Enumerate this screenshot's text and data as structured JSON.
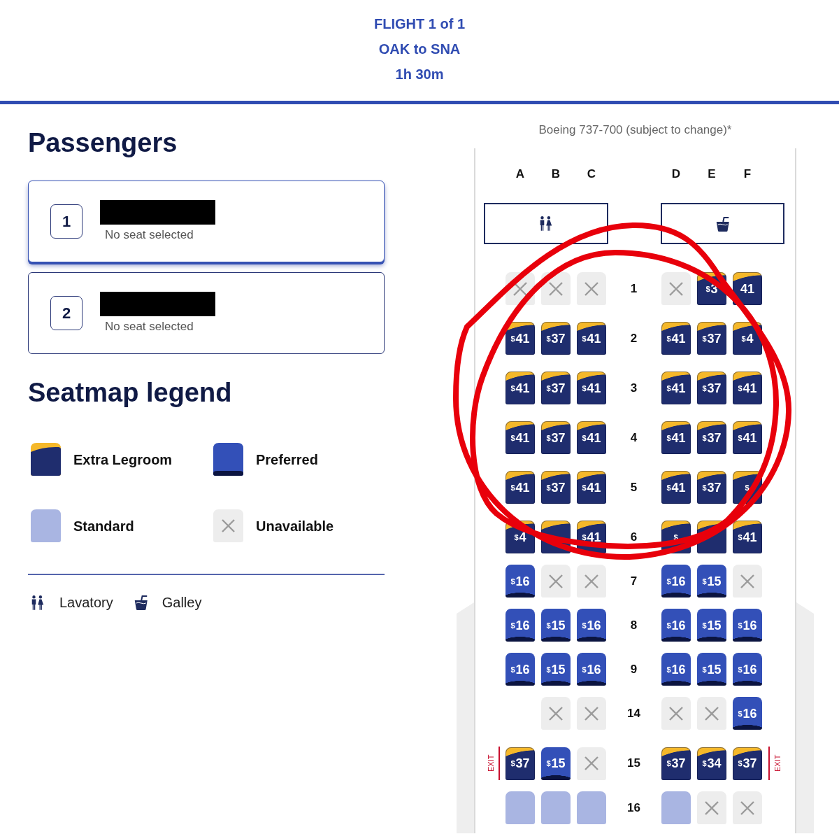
{
  "flight": {
    "title": "FLIGHT 1 of 1",
    "route": "OAK to SNA",
    "duration": "1h 30m"
  },
  "passengers": {
    "heading": "Passengers",
    "items": [
      {
        "number": "1",
        "name_redacted": true,
        "status": "No seat selected",
        "selected": true
      },
      {
        "number": "2",
        "name_redacted": true,
        "status": "No seat selected",
        "selected": false
      }
    ]
  },
  "legend": {
    "heading": "Seatmap legend",
    "items": [
      {
        "kind": "extra_legroom",
        "label": "Extra Legroom"
      },
      {
        "kind": "preferred",
        "label": "Preferred"
      },
      {
        "kind": "standard",
        "label": "Standard"
      },
      {
        "kind": "unavailable",
        "label": "Unavailable"
      }
    ],
    "facilities": [
      {
        "kind": "lavatory",
        "label": "Lavatory"
      },
      {
        "kind": "galley",
        "label": "Galley"
      }
    ]
  },
  "seatmap": {
    "aircraft": "Boeing 737-700 (subject to change)*",
    "columns_left": [
      "A",
      "B",
      "C"
    ],
    "columns_right": [
      "D",
      "E",
      "F"
    ],
    "facilities": [
      {
        "kind": "lavatory"
      },
      {
        "kind": "galley"
      }
    ],
    "rows": [
      {
        "number": "1",
        "left": [
          {
            "kind": "unavailable"
          },
          {
            "kind": "unavailable"
          },
          {
            "kind": "unavailable"
          }
        ],
        "right": [
          {
            "kind": "unavailable"
          },
          {
            "kind": "extra_legroom",
            "price": "$^{$}$3"
          },
          {
            "kind": "extra_legroom",
            "price": "41"
          }
        ]
      },
      {
        "number": "2",
        "left": [
          {
            "kind": "extra_legroom",
            "price": "$^{$}$41"
          },
          {
            "kind": "extra_legroom",
            "price": "$^{$}$37"
          },
          {
            "kind": "extra_legroom",
            "price": "$^{$}$41"
          }
        ],
        "right": [
          {
            "kind": "extra_legroom",
            "price": "$^{$}$41"
          },
          {
            "kind": "extra_legroom",
            "price": "$^{$}$37"
          },
          {
            "kind": "extra_legroom",
            "price": "$^{$}$4"
          }
        ]
      },
      {
        "number": "3",
        "left": [
          {
            "kind": "extra_legroom",
            "price": "$^{$}$41"
          },
          {
            "kind": "extra_legroom",
            "price": "$^{$}$37"
          },
          {
            "kind": "extra_legroom",
            "price": "$^{$}$41"
          }
        ],
        "right": [
          {
            "kind": "extra_legroom",
            "price": "$^{$}$41"
          },
          {
            "kind": "extra_legroom",
            "price": "$^{$}$37"
          },
          {
            "kind": "extra_legroom",
            "price": "$^{$}$41"
          }
        ]
      },
      {
        "number": "4",
        "left": [
          {
            "kind": "extra_legroom",
            "price": "$^{$}$41"
          },
          {
            "kind": "extra_legroom",
            "price": "$^{$}$37"
          },
          {
            "kind": "extra_legroom",
            "price": "$^{$}$41"
          }
        ],
        "right": [
          {
            "kind": "extra_legroom",
            "price": "$^{$}$41"
          },
          {
            "kind": "extra_legroom",
            "price": "$^{$}$37"
          },
          {
            "kind": "extra_legroom",
            "price": "$^{$}$41"
          }
        ]
      },
      {
        "number": "5",
        "left": [
          {
            "kind": "extra_legroom",
            "price": "$^{$}$41"
          },
          {
            "kind": "extra_legroom",
            "price": "$^{$}$37"
          },
          {
            "kind": "extra_legroom",
            "price": "$^{$}$41"
          }
        ],
        "right": [
          {
            "kind": "extra_legroom",
            "price": "$^{$}$41"
          },
          {
            "kind": "extra_legroom",
            "price": "$^{$}$37"
          },
          {
            "kind": "extra_legroom",
            "price": "$^{$}$"
          }
        ]
      },
      {
        "number": "6",
        "left": [
          {
            "kind": "extra_legroom",
            "price": "$^{$}$4"
          },
          {
            "kind": "extra_legroom"
          },
          {
            "kind": "extra_legroom",
            "price": "$^{$}$41"
          }
        ],
        "right": [
          {
            "kind": "extra_legroom",
            "price": "$^{$}$"
          },
          {
            "kind": "extra_legroom"
          },
          {
            "kind": "extra_legroom",
            "price": "$^{$}$41"
          }
        ]
      },
      {
        "number": "7",
        "left": [
          {
            "kind": "preferred",
            "price": "$^{$}$16"
          },
          {
            "kind": "unavailable"
          },
          {
            "kind": "unavailable"
          }
        ],
        "right": [
          {
            "kind": "preferred",
            "price": "$^{$}$16"
          },
          {
            "kind": "preferred",
            "price": "$^{$}$15"
          },
          {
            "kind": "unavailable"
          }
        ]
      },
      {
        "number": "8",
        "left": [
          {
            "kind": "preferred",
            "price": "$^{$}$16"
          },
          {
            "kind": "preferred",
            "price": "$^{$}$15"
          },
          {
            "kind": "preferred",
            "price": "$^{$}$16"
          }
        ],
        "right": [
          {
            "kind": "preferred",
            "price": "$^{$}$16"
          },
          {
            "kind": "preferred",
            "price": "$^{$}$15"
          },
          {
            "kind": "preferred",
            "price": "$^{$}$16"
          }
        ]
      },
      {
        "number": "9",
        "left": [
          {
            "kind": "preferred",
            "price": "$^{$}$16"
          },
          {
            "kind": "preferred",
            "price": "$^{$}$15"
          },
          {
            "kind": "preferred",
            "price": "$^{$}$16"
          }
        ],
        "right": [
          {
            "kind": "preferred",
            "price": "$^{$}$16"
          },
          {
            "kind": "preferred",
            "price": "$^{$}$15"
          },
          {
            "kind": "preferred",
            "price": "$^{$}$16"
          }
        ]
      },
      {
        "number": "14",
        "left": [
          {
            "kind": "unavailable"
          },
          {
            "kind": "unavailable"
          }
        ],
        "right": [
          {
            "kind": "unavailable"
          },
          {
            "kind": "unavailable"
          },
          {
            "kind": "preferred",
            "price": "$^{$}$16"
          }
        ]
      },
      {
        "number": "15",
        "exit_labels": [
          "EXIT",
          "EXIT"
        ],
        "left": [
          {
            "kind": "extra_legroom",
            "price": "$^{$}$37"
          },
          {
            "kind": "preferred",
            "price": "$^{$}$15"
          },
          {
            "kind": "unavailable"
          }
        ],
        "right": [
          {
            "kind": "extra_legroom",
            "price": "$^{$}$37"
          },
          {
            "kind": "extra_legroom",
            "price": "$^{$}$34"
          },
          {
            "kind": "extra_legroom",
            "price": "$^{$}$37"
          }
        ]
      },
      {
        "number": "16",
        "left": [
          {
            "kind": "standard"
          },
          {
            "kind": "standard"
          },
          {
            "kind": "standard"
          }
        ],
        "right": [
          {
            "kind": "standard"
          },
          {
            "kind": "unavailable"
          },
          {
            "kind": "unavailable"
          }
        ]
      }
    ],
    "annotation": {
      "kind": "circle"
    }
  }
}
